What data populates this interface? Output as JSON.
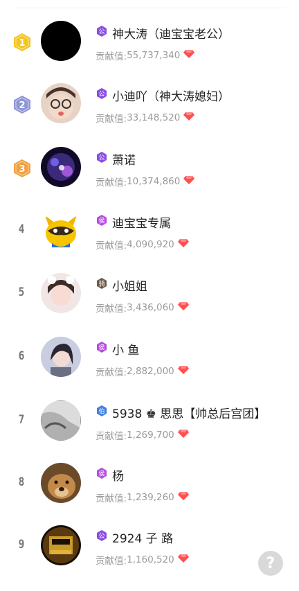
{
  "list": {
    "contribution_label": "贡献值:",
    "rows": [
      {
        "rank": "1",
        "level_char": "公",
        "level_color": "#8a4fe0",
        "name": "神大涛（迪宝宝老公）",
        "value": "55,737,340"
      },
      {
        "rank": "2",
        "level_char": "公",
        "level_color": "#8a4fe0",
        "name": "小迪吖（神大涛媳妇）",
        "value": "33,148,520"
      },
      {
        "rank": "3",
        "level_char": "公",
        "level_color": "#8a4fe0",
        "name": "萧诺",
        "value": "10,374,860"
      },
      {
        "rank": "4",
        "level_char": "侯",
        "level_color": "#b44fe0",
        "name": "迪宝宝专属",
        "value": "4,090,920"
      },
      {
        "rank": "5",
        "level_char": "骑",
        "level_color": "#6b5a47",
        "name": "小姐姐",
        "value": "3,436,060"
      },
      {
        "rank": "6",
        "level_char": "侯",
        "level_color": "#b44fe0",
        "name": "小 鱼",
        "value": "2,882,000"
      },
      {
        "rank": "7",
        "level_char": "伯",
        "level_color": "#3d7fe0",
        "name": "5938 ♚ 思思【帅总后宫团】",
        "value": "1,269,700"
      },
      {
        "rank": "8",
        "level_char": "侯",
        "level_color": "#b44fe0",
        "name": "杨",
        "value": "1,239,260"
      },
      {
        "rank": "9",
        "level_char": "公",
        "level_color": "#8a4fe0",
        "name": "2924 子 路",
        "value": "1,160,520"
      }
    ]
  },
  "help": {
    "label": "?"
  },
  "colors": {
    "gold": "#f2c520",
    "silver": "#8e96d8",
    "bronze": "#f0a040",
    "diamond": "#ff4d4d"
  }
}
